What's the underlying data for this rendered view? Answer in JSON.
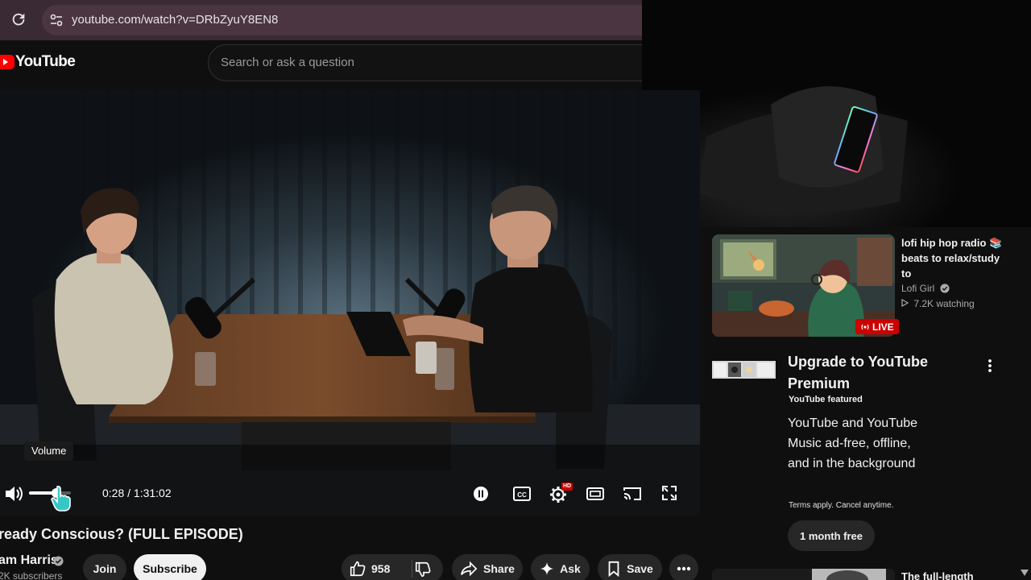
{
  "browser": {
    "url": "youtube.com/watch?v=DRbZyuY8EN8"
  },
  "header": {
    "logo_text": "YouTube",
    "search_placeholder": "Search or ask a question"
  },
  "player": {
    "tooltip": "Volume",
    "time": "0:28 / 1:31:02",
    "volume_level": 0.65,
    "settings_badge": "HD"
  },
  "video": {
    "title": "ready Conscious? (FULL EPISODE)",
    "channel": "am Harris",
    "subscribers": "2K subscribers",
    "like_count": "958",
    "join_label": "Join",
    "subscribe_label": "Subscribe",
    "share_label": "Share",
    "ask_label": "Ask",
    "save_label": "Save"
  },
  "sidebar": {
    "lofi": {
      "title": "lofi hip hop radio 📚 beats to relax/study to",
      "channel": "Lofi Girl",
      "watching": "7.2K watching",
      "live_label": "LIVE"
    },
    "premium": {
      "title": "Upgrade to YouTube Premium",
      "tag": "YouTube featured",
      "description": "YouTube and YouTube Music ad-free, offline, and in the background",
      "terms": "Terms apply. Cancel anytime.",
      "button": "1 month free"
    },
    "next_title": "The full-length"
  },
  "colors": {
    "brand_red": "#ff0000",
    "live_red": "#cc0000",
    "browser_bar": "#3a2a33"
  }
}
